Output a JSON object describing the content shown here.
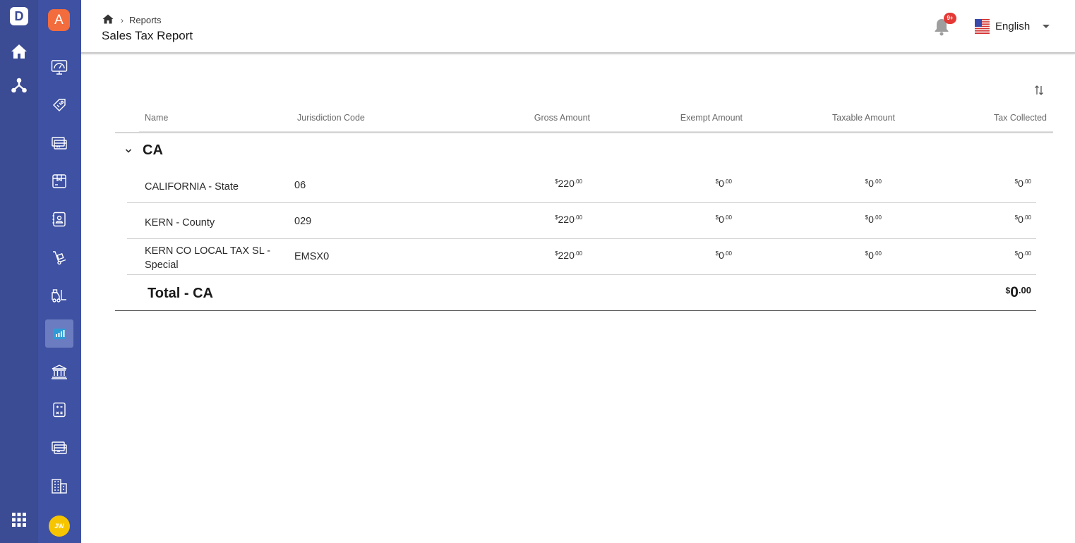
{
  "app": {
    "logo_letter": "D",
    "org_badge": "A",
    "avatar_initials": "JW"
  },
  "header": {
    "breadcrumb": [
      "Reports"
    ],
    "title": "Sales Tax Report",
    "notifications_badge": "9+",
    "language": "English"
  },
  "nav_icons": [
    "dashboard-icon",
    "tag-icon",
    "card-icon",
    "box-icon",
    "contacts-icon",
    "hand-truck-icon",
    "forklift-icon",
    "reports-icon",
    "bank-icon",
    "calculator-icon",
    "payment-icon",
    "building-icon"
  ],
  "colors": {
    "rail_outer": "#3b4b94",
    "rail_inner": "#3e51a3",
    "active_item": "#6b7cc0",
    "org_badge": "#f36c3d",
    "avatar": "#f7c500",
    "badge_red": "#e53935"
  },
  "table": {
    "columns": [
      "Name",
      "Jurisdiction Code",
      "Gross Amount",
      "Exempt Amount",
      "Taxable Amount",
      "Tax Collected"
    ],
    "group": {
      "label": "CA",
      "rows": [
        {
          "name": [
            "CALIFORNIA - State"
          ],
          "code": "06",
          "gross": {
            "cur": "$",
            "int": "220",
            "dec": ".00"
          },
          "exempt": {
            "cur": "$",
            "int": "0",
            "dec": ".00"
          },
          "taxable": {
            "cur": "$",
            "int": "0",
            "dec": ".00"
          },
          "collected": {
            "cur": "$",
            "int": "0",
            "dec": ".00"
          }
        },
        {
          "name": [
            "KERN - County"
          ],
          "code": "029",
          "gross": {
            "cur": "$",
            "int": "220",
            "dec": ".00"
          },
          "exempt": {
            "cur": "$",
            "int": "0",
            "dec": ".00"
          },
          "taxable": {
            "cur": "$",
            "int": "0",
            "dec": ".00"
          },
          "collected": {
            "cur": "$",
            "int": "0",
            "dec": ".00"
          }
        },
        {
          "name": [
            "KERN CO LOCAL TAX SL -",
            "Special"
          ],
          "code": "EMSX0",
          "gross": {
            "cur": "$",
            "int": "220",
            "dec": ".00"
          },
          "exempt": {
            "cur": "$",
            "int": "0",
            "dec": ".00"
          },
          "taxable": {
            "cur": "$",
            "int": "0",
            "dec": ".00"
          },
          "collected": {
            "cur": "$",
            "int": "0",
            "dec": ".00"
          }
        }
      ],
      "total_label": "Total - CA",
      "total": {
        "cur": "$",
        "int": "0",
        "dec": ".00"
      }
    }
  }
}
